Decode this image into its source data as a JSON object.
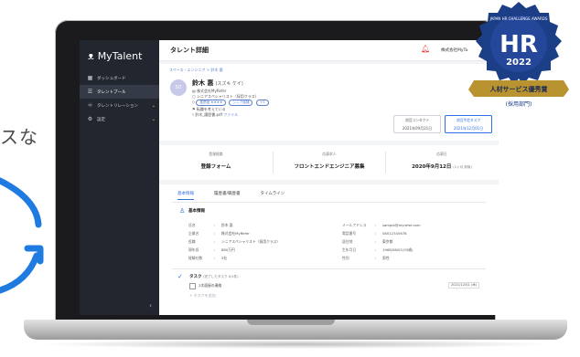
{
  "promo": {
    "text": "スな"
  },
  "app": {
    "logo": "MyTalent",
    "header_title": "タレント詳細",
    "company": "株式会社MyTa",
    "sidebar": [
      {
        "icon": "dashboard-icon",
        "label": "ダッシュボード"
      },
      {
        "icon": "list-icon",
        "label": "タレントプール",
        "active": true
      },
      {
        "icon": "relation-icon",
        "label": "タレントリレーション",
        "caret": "⌄"
      },
      {
        "icon": "gear-icon",
        "label": "設定",
        "caret": "⌄"
      }
    ],
    "collapse": "‹"
  },
  "profile": {
    "breadcrumb": "スペース・エンジニア > 鈴木 惠",
    "avatar": "SO",
    "name": "鈴木 惠",
    "kana": "(スズキ ケイ)",
    "company_line": "株式会社MyRefer",
    "role_line": "シニアスペシャリスト（採用クラス）",
    "tags": [
      "推薦度 ★★★★",
      "シニア候補",
      "＋5"
    ],
    "extra": "+5",
    "note_line": "転職を考えている",
    "file_name": "鈴木_履歴書.pdf",
    "file_link": "ファイル",
    "more": "• その他",
    "next_contact_label": "次回コンタクト",
    "next_contact": "2021年09月21日",
    "next_task_label": "次回予定タスク",
    "next_task": "2021年12月01日"
  },
  "summary": [
    {
      "label": "登録経路",
      "value": "登録フォーム"
    },
    {
      "label": "応募求人",
      "value": "フロントエンドエンジニア募集"
    },
    {
      "label": "応募日",
      "value": "2020年9月12日",
      "note": "(1ヶ月 前後)"
    }
  ],
  "detail": {
    "tabs": [
      "基本情報",
      "履歴書/職歴書",
      "タイムライン"
    ],
    "section_title": "基本情報",
    "left_fields": [
      {
        "k": "氏名",
        "v": "鈴木 惠"
      },
      {
        "k": "企業名",
        "v": "株式会社MyRefer"
      },
      {
        "k": "役職",
        "v": "シニアスペシャリスト（採用クラス）"
      },
      {
        "k": "現年収",
        "v": "880万円"
      },
      {
        "k": "経験社数",
        "v": "5社"
      }
    ],
    "right_fields": [
      {
        "k": "メールアドレス",
        "v": "sample@myrefer.com"
      },
      {
        "k": "電話番号",
        "v": "08012345678"
      },
      {
        "k": "居住地",
        "v": "東京都"
      },
      {
        "k": "生年月日",
        "v": "1968/08/01(53歳)"
      },
      {
        "k": "性別",
        "v": "男性"
      }
    ],
    "task_title": "タスク",
    "task_count": "(完了したタスク 0/1件)",
    "task_item": "2次面接の連絡",
    "task_date": "2021/12/01 (木)",
    "task_add": "+ タスクを追加"
  },
  "award": {
    "arc_text": "JAPAN HR CHALLENGE AWARDS",
    "logo": "HR",
    "year": "2022",
    "ribbon": "人材サービス優秀賞",
    "sub": "(採用部門)"
  }
}
